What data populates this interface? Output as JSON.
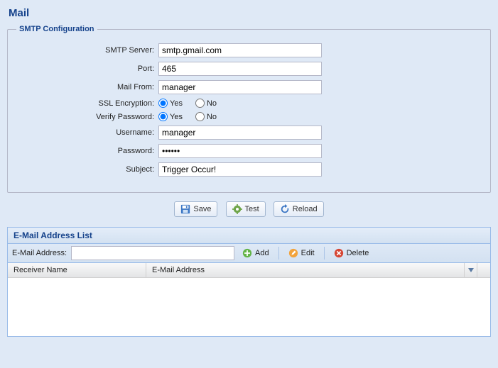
{
  "page_title": "Mail",
  "smtp": {
    "legend": "SMTP Configuration",
    "fields": {
      "server_label": "SMTP Server:",
      "server_value": "smtp.gmail.com",
      "port_label": "Port:",
      "port_value": "465",
      "mailfrom_label": "Mail From:",
      "mailfrom_value": "manager",
      "ssl_label": "SSL Encryption:",
      "ssl_yes": "Yes",
      "ssl_no": "No",
      "ssl_selected": "yes",
      "verify_label": "Verify Password:",
      "verify_yes": "Yes",
      "verify_no": "No",
      "verify_selected": "yes",
      "username_label": "Username:",
      "username_value": "manager",
      "password_label": "Password:",
      "password_value": "••••••",
      "subject_label": "Subject:",
      "subject_value": "Trigger Occur!"
    }
  },
  "buttons": {
    "save": "Save",
    "test": "Test",
    "reload": "Reload"
  },
  "list_panel": {
    "title": "E-Mail Address List",
    "toolbar": {
      "label": "E-Mail Address:",
      "value": "",
      "add": "Add",
      "edit": "Edit",
      "delete": "Delete"
    },
    "columns": {
      "receiver": "Receiver Name",
      "email": "E-Mail Address"
    },
    "rows": []
  }
}
